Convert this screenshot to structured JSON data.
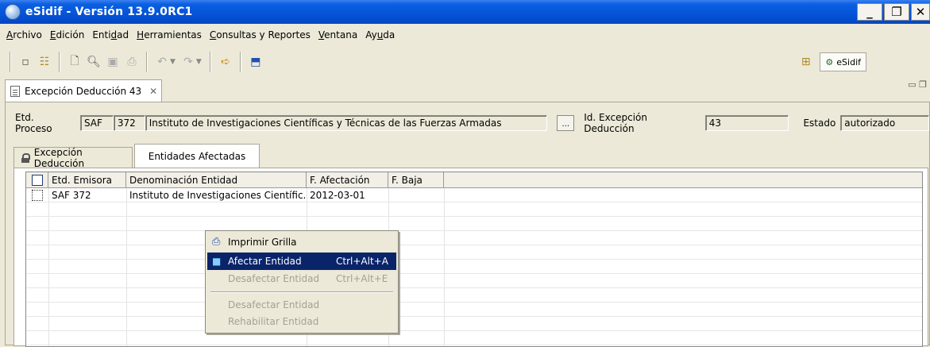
{
  "window": {
    "title": "eSidif - Versión 13.9.0RC1"
  },
  "menu": [
    {
      "label": "Archivo",
      "mnemonic": "A",
      "rest": "rchivo"
    },
    {
      "label": "Edición",
      "mnemonic": "E",
      "rest": "dición"
    },
    {
      "label": "Entidad",
      "pre": "Enti",
      "mnemonic": "d",
      "rest": "ad"
    },
    {
      "label": "Herramientas",
      "mnemonic": "H",
      "rest": "erramientas"
    },
    {
      "label": "Consultas y Reportes",
      "mnemonic": "C",
      "rest": "onsultas y Reportes"
    },
    {
      "label": "Ventana",
      "mnemonic": "V",
      "rest": "entana"
    },
    {
      "label": "Ayuda",
      "pre": "Ay",
      "mnemonic": "u",
      "rest": "da"
    }
  ],
  "perspective": {
    "label": "eSidif"
  },
  "editor_tab": {
    "label": "Excepción Deducción 43"
  },
  "form": {
    "etd_proceso_label": "Etd. Proceso",
    "etd_tipo": "SAF",
    "etd_numero": "372",
    "etd_nombre": "Instituto de Investigaciones Científicas y Técnicas de las Fuerzas Armadas",
    "dots_label": "...",
    "id_label": "Id. Excepción Deducción",
    "id_value": "43",
    "estado_label": "Estado",
    "estado_value": "autorizado"
  },
  "tabs": [
    {
      "label": "Excepción Deducción"
    },
    {
      "label": "Entidades Afectadas"
    }
  ],
  "grid": {
    "columns": [
      "Etd. Emisora",
      "Denominación Entidad",
      "F. Afectación",
      "F. Baja"
    ],
    "rows": [
      {
        "etd": "SAF 372",
        "denominacion": "Instituto de Investigaciones Científic...",
        "f_afectacion": "2012-03-01",
        "f_baja": ""
      }
    ]
  },
  "context_menu": {
    "items": [
      {
        "label": "Imprimir Grilla",
        "shortcut": "",
        "state": "enabled"
      },
      {
        "label": "Afectar Entidad",
        "shortcut": "Ctrl+Alt+A",
        "state": "selected"
      },
      {
        "label": "Desafectar Entidad",
        "shortcut": "Ctrl+Alt+E",
        "state": "disabled"
      },
      {
        "label": "Desafectar Entidad",
        "shortcut": "",
        "state": "disabled"
      },
      {
        "label": "Rehabilitar Entidad",
        "shortcut": "",
        "state": "disabled"
      }
    ]
  }
}
